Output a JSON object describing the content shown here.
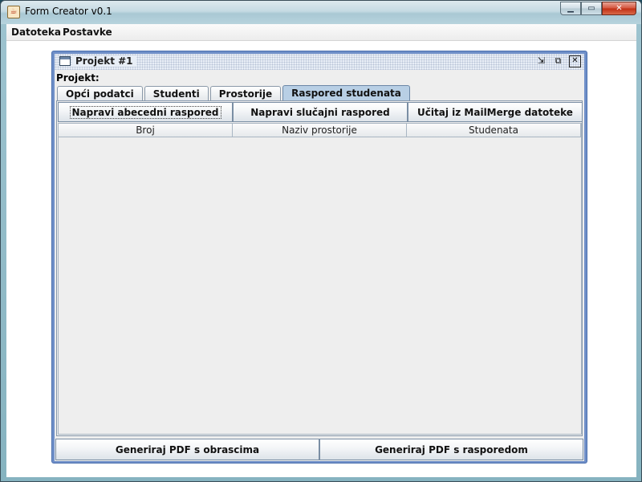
{
  "window": {
    "title": "Form Creator v0.1",
    "icon": "java-coffee-icon",
    "controls": {
      "minimize": "minimize-icon",
      "maximize": "maximize-icon",
      "close": "close-icon"
    }
  },
  "menubar": {
    "items": [
      {
        "label": "Datoteka"
      },
      {
        "label": "Postavke"
      }
    ]
  },
  "internal_frame": {
    "title": "Projekt #1",
    "project_label": "Projekt:",
    "tabs": [
      {
        "label": "Opći podatci",
        "active": false
      },
      {
        "label": "Studenti",
        "active": false
      },
      {
        "label": "Prostorije",
        "active": false
      },
      {
        "label": "Raspored studenata",
        "active": true
      }
    ],
    "actions": [
      {
        "label": "Napravi abecedni raspored"
      },
      {
        "label": "Napravi slučajni raspored"
      },
      {
        "label": "Učitaj iz MailMerge datoteke"
      }
    ],
    "table": {
      "columns": [
        "Broj",
        "Naziv prostorije",
        "Studenata"
      ],
      "rows": []
    },
    "bottom_actions": [
      {
        "label": "Generiraj PDF s obrascima"
      },
      {
        "label": "Generiraj PDF s rasporedom"
      }
    ]
  }
}
